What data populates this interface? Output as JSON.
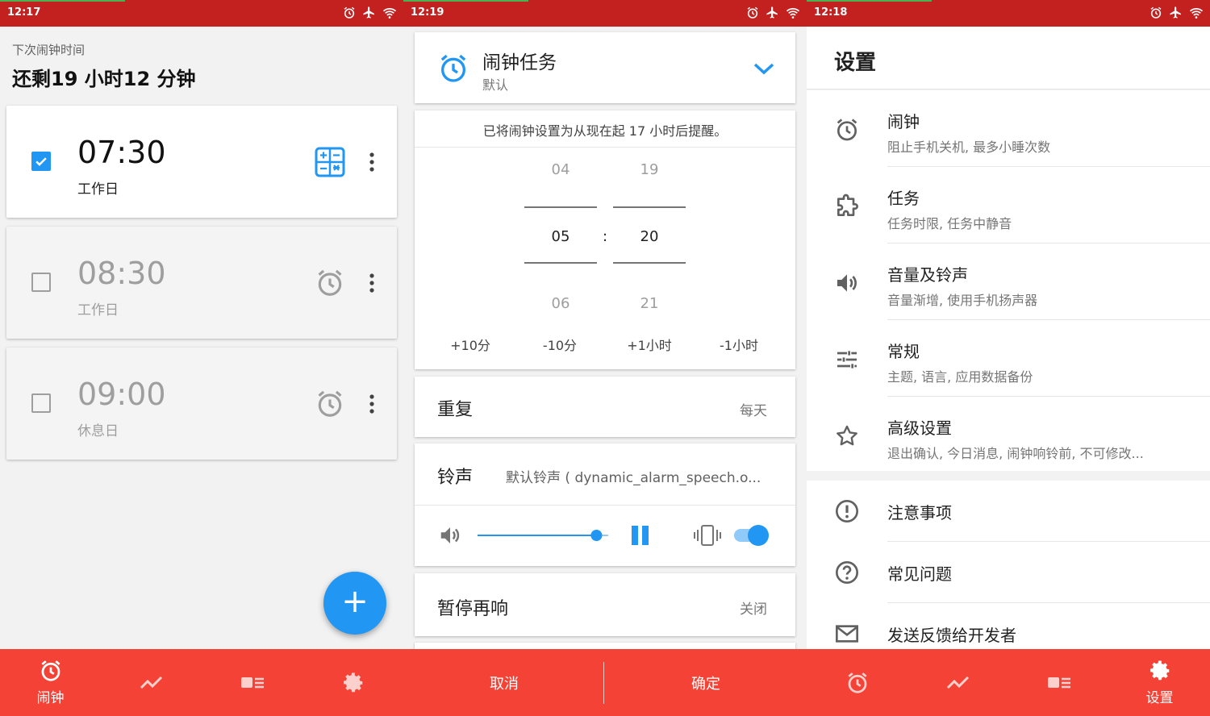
{
  "colors": {
    "statusbar": "#c32020",
    "bottombar": "#f44336",
    "accent": "#2196f3"
  },
  "screens": {
    "alarms": {
      "status_time": "12:17",
      "next_label": "下次闹钟时间",
      "next_value": "还剩19 小时12 分钟",
      "alarms": [
        {
          "time": "07:30",
          "days": "工作日",
          "enabled": true,
          "mission_icon": "calculator-icon"
        },
        {
          "time": "08:30",
          "days": "工作日",
          "enabled": false,
          "mission_icon": "alarm-clock-icon"
        },
        {
          "time": "09:00",
          "days": "休息日",
          "enabled": false,
          "mission_icon": "alarm-clock-icon"
        }
      ],
      "fab_label": "+",
      "nav": {
        "alarm_label": "闹钟"
      }
    },
    "editor": {
      "status_time": "12:19",
      "task_title": "闹钟任务",
      "task_sub": "默认",
      "hint": "已将闹钟设置为从现在起 17 小时后提醒。",
      "picker": {
        "hour_prev": "04",
        "hour": "05",
        "hour_next": "06",
        "minute_prev": "19",
        "minute": "20",
        "minute_next": "21",
        "separator": ":"
      },
      "quick": [
        "+10分",
        "-10分",
        "+1小时",
        "-1小时"
      ],
      "repeat_label": "重复",
      "repeat_value": "每天",
      "ringtone_label": "铃声",
      "ringtone_value": "默认铃声 ( dynamic_alarm_speech.o...",
      "volume": 0.91,
      "vibrate_on": true,
      "snooze_label": "暂停再响",
      "snooze_value": "关闭",
      "cancel": "取消",
      "confirm": "确定"
    },
    "settings": {
      "status_time": "12:18",
      "title": "设置",
      "items": [
        {
          "icon": "alarm-clock-icon",
          "title": "闹钟",
          "sub": "阻止手机关机, 最多小睡次数"
        },
        {
          "icon": "puzzle-icon",
          "title": "任务",
          "sub": "任务时限, 任务中静音"
        },
        {
          "icon": "volume-icon",
          "title": "音量及铃声",
          "sub": "音量渐增, 使用手机扬声器"
        },
        {
          "icon": "sliders-icon",
          "title": "常规",
          "sub": "主题, 语言, 应用数据备份"
        },
        {
          "icon": "star-icon",
          "title": "高级设置",
          "sub": "退出确认, 今日消息, 闹钟响铃前, 不可修改..."
        }
      ],
      "items2": [
        {
          "icon": "alert-icon",
          "title": "注意事项"
        },
        {
          "icon": "help-icon",
          "title": "常见问题"
        },
        {
          "icon": "mail-icon",
          "title": "发送反馈给开发者"
        }
      ],
      "nav": {
        "settings_label": "设置"
      }
    }
  }
}
